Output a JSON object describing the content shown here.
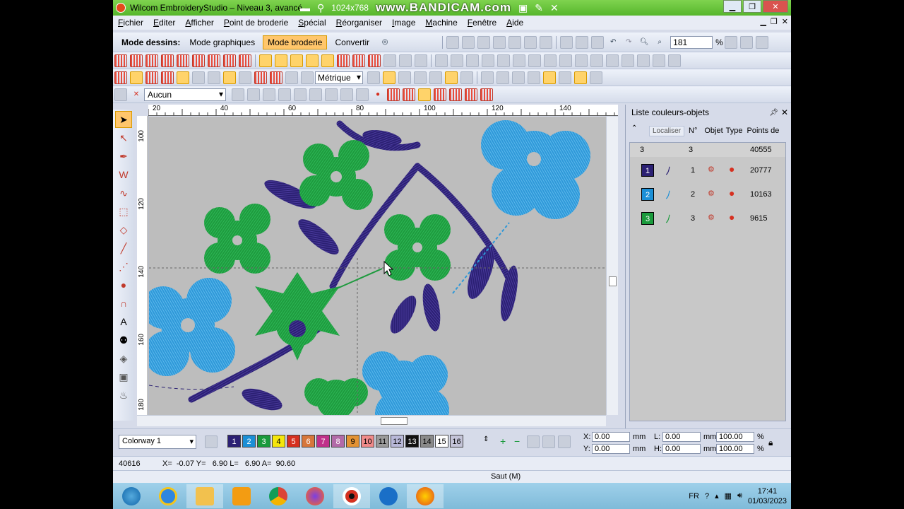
{
  "window": {
    "title": "Wilcom EmbroideryStudio – Niveau 3, avancé –",
    "recorder_brand": "www.BANDICAM.com",
    "recorder_resolution": "1024x768"
  },
  "menu": [
    "Fichier",
    "Editer",
    "Afficher",
    "Point de broderie",
    "Spécial",
    "Réorganiser",
    "Image",
    "Machine",
    "Fenêtre",
    "Aide"
  ],
  "modebar": {
    "label": "Mode dessins:",
    "graphics_mode": "Mode graphiques",
    "embroidery_mode": "Mode broderie",
    "convert": "Convertir"
  },
  "zoom": "181",
  "zoom_unit": "%",
  "units": "Métrique",
  "object_prop": "Aucun",
  "ruler": {
    "h": [
      "20",
      "40",
      "60",
      "80",
      "100",
      "120",
      "140"
    ],
    "v": [
      "100",
      "120",
      "140",
      "160",
      "180"
    ]
  },
  "panel": {
    "title": "Liste couleurs-objets",
    "locate": "Localiser",
    "headers": {
      "no": "N°",
      "object": "Objet",
      "type": "Type",
      "points": "Points de"
    },
    "summary": {
      "count": "3",
      "no": "3",
      "points": "40555"
    },
    "rows": [
      {
        "color_no": "1",
        "no": "1",
        "points": "20777",
        "color": "#2b2073"
      },
      {
        "color_no": "2",
        "no": "2",
        "points": "10163",
        "color": "#1b8fd6"
      },
      {
        "color_no": "3",
        "no": "3",
        "points": "9615",
        "color": "#1a9a3c"
      }
    ]
  },
  "colorway": "Colorway 1",
  "palette": [
    {
      "n": "1",
      "bg": "#2b2073",
      "fg": "#fff"
    },
    {
      "n": "2",
      "bg": "#1b8fd6",
      "fg": "#fff"
    },
    {
      "n": "3",
      "bg": "#1a9a3c",
      "fg": "#fff"
    },
    {
      "n": "4",
      "bg": "#f5e60c",
      "fg": "#000"
    },
    {
      "n": "5",
      "bg": "#d63020",
      "fg": "#fff"
    },
    {
      "n": "6",
      "bg": "#d7763b",
      "fg": "#fff"
    },
    {
      "n": "7",
      "bg": "#c0308a",
      "fg": "#fff"
    },
    {
      "n": "8",
      "bg": "#b26aa8",
      "fg": "#fff"
    },
    {
      "n": "9",
      "bg": "#e39234",
      "fg": "#000"
    },
    {
      "n": "10",
      "bg": "#f08a8a",
      "fg": "#000"
    },
    {
      "n": "11",
      "bg": "#9a9a9a",
      "fg": "#000"
    },
    {
      "n": "12",
      "bg": "#b8b8d8",
      "fg": "#000"
    },
    {
      "n": "13",
      "bg": "#111111",
      "fg": "#fff"
    },
    {
      "n": "14",
      "bg": "#8a8a8a",
      "fg": "#000"
    },
    {
      "n": "15",
      "bg": "#ffffff",
      "fg": "#000"
    },
    {
      "n": "16",
      "bg": "#c4c4d8",
      "fg": "#000"
    }
  ],
  "coords": {
    "x_label": "X:",
    "y_label": "Y:",
    "l_label": "L:",
    "h_label": "H:",
    "x": "0.00",
    "y": "0.00",
    "l": "0.00",
    "h": "0.00",
    "unit": "mm",
    "scale_w": "100.00",
    "scale_h": "100.00",
    "pct": "%"
  },
  "status": {
    "count": "40616",
    "readout": "X=  -0.07 Y=   6.90 L=   6.90 A=  90.60",
    "hint": "Saut (M)"
  },
  "tray": {
    "lang": "FR",
    "time": "17:41",
    "date": "01/03/2023"
  },
  "colors": {
    "titlebar": "#56b62c",
    "accent": "#ffc66b",
    "canvas": "#bdbdbd"
  }
}
